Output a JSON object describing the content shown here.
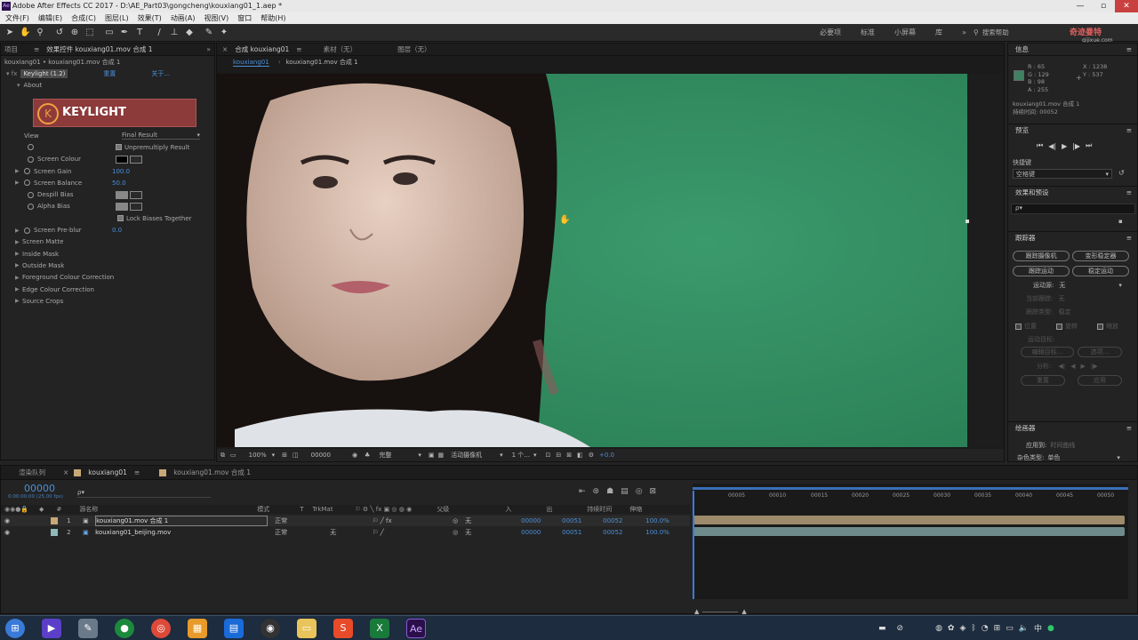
{
  "window": {
    "title": "Adobe After Effects CC 2017 - D:\\AE_Part03\\gongcheng\\kouxiang01_1.aep *"
  },
  "menu": [
    "文件(F)",
    "编辑(E)",
    "合成(C)",
    "图层(L)",
    "效果(T)",
    "动画(A)",
    "视图(V)",
    "窗口",
    "帮助(H)"
  ],
  "workspaces": [
    "必要项",
    "标准",
    "小屏幕",
    "库"
  ],
  "search_help": "搜索帮助",
  "watermark": {
    "brand": "奇迹曼特",
    "url": "qijixue.com"
  },
  "effect_panel": {
    "tab_project": "项目",
    "tab_label": "效果控件 kouxiang01.mov 合成 1",
    "breadcrumb": "kouxiang01 • kouxiang01.mov 合成 1",
    "effect_name": "Keylight (1.2)",
    "reset": "重置",
    "about_link": "关于...",
    "about": "About",
    "logo_text": "KEYLIGHT",
    "view_label": "View",
    "view_value": "Final Result",
    "unpremultiply": "Unpremultiply Result",
    "screen_colour": "Screen Colour",
    "screen_gain": "Screen Gain",
    "screen_gain_value": "100.0",
    "screen_balance": "Screen Balance",
    "screen_balance_value": "50.0",
    "despill_bias": "Despill Bias",
    "alpha_bias": "Alpha Bias",
    "lock_biases": "Lock Biases Together",
    "screen_preblur": "Screen Pre-blur",
    "screen_preblur_value": "0.0",
    "groups": [
      "Screen Matte",
      "Inside Mask",
      "Outside Mask",
      "Foreground Colour Correction",
      "Edge Colour Correction",
      "Source Crops"
    ]
  },
  "comp_panel": {
    "tab_comp": "合成 kouxiang01",
    "tab_footage": "素材（无）",
    "tab_layer": "图层（无）",
    "crumb1": "kouxiang01",
    "crumb2": "kouxiang01.mov 合成 1",
    "zoom": "100%",
    "timecode": "00000",
    "resolution": "完整",
    "camera": "活动摄像机",
    "views": "1 个...",
    "exposure": "+0.0"
  },
  "info_panel": {
    "title": "信息",
    "r": "R : 65",
    "g": "G : 129",
    "b": "B : 98",
    "a": "A : 255",
    "x": "X : 1238",
    "y": "Y : 537",
    "line1": "kouxiang01.mov 合成 1",
    "line2": "持续时间: 00052",
    "color_hex": "#3f8162"
  },
  "preview_panel": {
    "title": "预览"
  },
  "shortcut": {
    "label": "快捷键",
    "value": "空格键"
  },
  "effects_presets": {
    "title": "效果和预设",
    "search_placeholder": "ρ▾"
  },
  "tracker": {
    "title": "跟踪器",
    "track_camera": "跟踪摄像机",
    "warp_stabilizer": "变形稳定器",
    "track_motion": "跟踪运动",
    "stabilize_motion": "稳定运动",
    "motion_source_label": "运动源:",
    "motion_source_value": "无",
    "current_track": "当前跟踪:",
    "current_track_value": "无",
    "track_type": "跟踪类型:",
    "track_type_value": "稳定",
    "position": "位置",
    "rotation": "旋转",
    "scale": "缩放",
    "motion_target": "运动目标:",
    "edit_target": "编辑目标...",
    "options": "选项...",
    "analyze": "分析:",
    "reset": "重置",
    "apply": "应用"
  },
  "mask_panel": {
    "title": "绘画器",
    "apply_to": "应用到:",
    "apply_to_value": "时间曲线",
    "color_type": "杂色类型:",
    "color_type_value": "单色"
  },
  "timeline": {
    "tab_render": "渲染队列",
    "tab_comp": "kouxiang01",
    "tab_comp2": "kouxiang01.mov 合成 1",
    "timecode": "00000",
    "timecode_sub": "0:00:00:00 (25.00 fps)",
    "columns": {
      "num": "#",
      "source": "源名称",
      "mode": "模式",
      "t": "T",
      "trkmat": "TrkMat",
      "parent": "父级",
      "in": "入",
      "out": "出",
      "duration": "持续时间",
      "stretch": "伸缩"
    },
    "ruler": [
      "00005",
      "00010",
      "00015",
      "00020",
      "00025",
      "00030",
      "00035",
      "00040",
      "00045",
      "00050"
    ],
    "layers": [
      {
        "num": "1",
        "name": "kouxiang01.mov 合成 1",
        "mode": "正常",
        "trkmat": "",
        "parent": "无",
        "in": "00000",
        "out": "00051",
        "duration": "00052",
        "stretch": "100.0%",
        "label_color": "#c8a878"
      },
      {
        "num": "2",
        "name": "kouxiang01_beijing.mov",
        "mode": "正常",
        "trkmat": "无",
        "parent": "无",
        "in": "00000",
        "out": "00051",
        "duration": "00052",
        "stretch": "100.0%",
        "label_color": "#8fb8b8"
      }
    ]
  },
  "taskbar": {
    "icons": [
      "start-icon",
      "media-icon",
      "feather-icon",
      "player-icon",
      "chrome-icon",
      "windows-icon",
      "store-icon",
      "obs-icon",
      "folder-icon",
      "s-app-icon",
      "excel-icon",
      "after-effects-icon"
    ],
    "ae_label": "Ae"
  }
}
